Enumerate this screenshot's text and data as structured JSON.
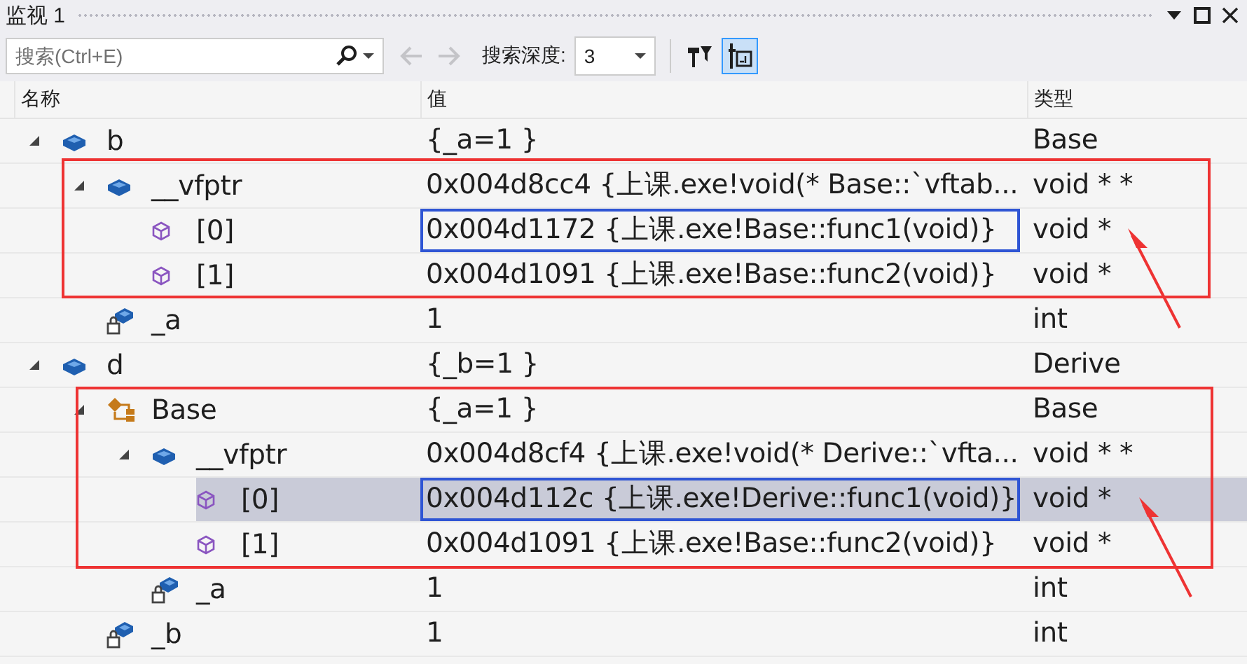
{
  "window": {
    "title": "监视 1"
  },
  "toolbar": {
    "search": {
      "placeholder": "搜索(Ctrl+E)"
    },
    "back_disabled": true,
    "forward_disabled": true,
    "depth_label": "搜索深度:",
    "depth_value": "3",
    "hex_display": {
      "on": true
    }
  },
  "table": {
    "columns": [
      "名称",
      "值",
      "类型"
    ],
    "rows": [
      {
        "name": "b",
        "value": "{_a=1 }",
        "type": "Base",
        "kind": "object",
        "expanded": true,
        "selected": false,
        "children": [
          {
            "name": "__vfptr",
            "value": "0x004d8cc4 {上课.exe!void(* Base::`vftab...",
            "type": "void * *",
            "kind": "object",
            "expanded": true,
            "selected": false,
            "children": [
              {
                "name": "[0]",
                "value": "0x004d1172 {上课.exe!Base::func1(void)}",
                "type": "void *",
                "kind": "element",
                "selected": false,
                "boxed": true
              },
              {
                "name": "[1]",
                "value": "0x004d1091 {上课.exe!Base::func2(void)}",
                "type": "void *",
                "kind": "element",
                "selected": false,
                "boxed": false
              }
            ]
          },
          {
            "name": "_a",
            "value": "1",
            "type": "int",
            "kind": "private_field",
            "selected": false
          }
        ]
      },
      {
        "name": "d",
        "value": "{_b=1 }",
        "type": "Derive",
        "kind": "object",
        "expanded": true,
        "selected": false,
        "children": [
          {
            "name": "Base",
            "value": "{_a=1 }",
            "type": "Base",
            "kind": "base_class",
            "expanded": true,
            "selected": false,
            "children": [
              {
                "name": "__vfptr",
                "value": "0x004d8cf4 {上课.exe!void(* Derive::`vfta...",
                "type": "void * *",
                "kind": "object",
                "expanded": true,
                "selected": false,
                "children": [
                  {
                    "name": "[0]",
                    "value": "0x004d112c {上课.exe!Derive::func1(void)}",
                    "type": "void *",
                    "kind": "element",
                    "selected": true,
                    "boxed": true
                  },
                  {
                    "name": "[1]",
                    "value": "0x004d1091 {上课.exe!Base::func2(void)}",
                    "type": "void *",
                    "kind": "element",
                    "selected": false,
                    "boxed": false
                  }
                ]
              },
              {
                "name": "_a",
                "value": "1",
                "type": "int",
                "kind": "private_field",
                "selected": false
              }
            ]
          },
          {
            "name": "_b",
            "value": "1",
            "type": "int",
            "kind": "private_field",
            "selected": false
          }
        ]
      }
    ]
  }
}
